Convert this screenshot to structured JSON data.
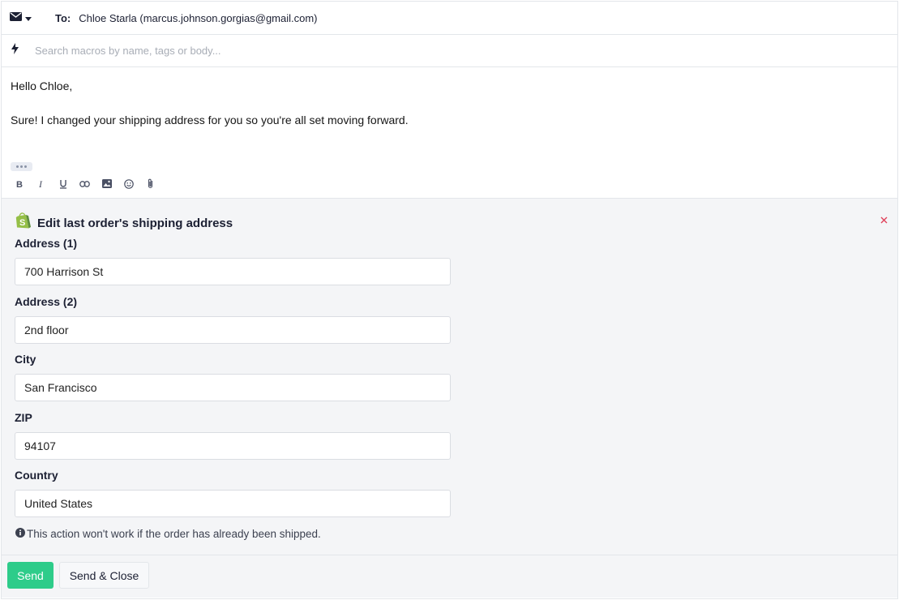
{
  "header": {
    "to_label": "To:",
    "recipient": "Chloe Starla (marcus.johnson.gorgias@gmail.com)",
    "channel_icon": "mail-icon"
  },
  "macro_search": {
    "placeholder": "Search macros by name, tags or body...",
    "value": ""
  },
  "message": {
    "greeting": "Hello Chloe,",
    "body": "Sure! I changed your shipping address for you so you're all set moving forward."
  },
  "toolbar": {
    "tools": [
      "bold",
      "italic",
      "underline",
      "link",
      "image",
      "emoji",
      "attachment"
    ]
  },
  "action_panel": {
    "title": "Edit last order's shipping address",
    "brand_icon": "shopify-icon",
    "brand_color": "#95bf47",
    "fields": [
      {
        "label": "Address (1)",
        "value": "700 Harrison St"
      },
      {
        "label": "Address (2)",
        "value": "2nd floor"
      },
      {
        "label": "City",
        "value": "San Francisco"
      },
      {
        "label": "ZIP",
        "value": "94107"
      },
      {
        "label": "Country",
        "value": "United States"
      }
    ],
    "notice": "This action won't work if the order has already been shipped."
  },
  "footer": {
    "send_label": "Send",
    "send_close_label": "Send & Close",
    "send_color": "#2ecc8a"
  }
}
